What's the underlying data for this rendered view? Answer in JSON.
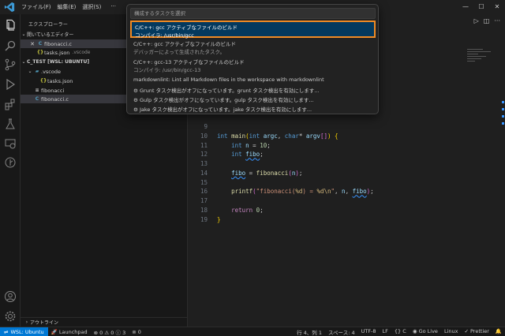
{
  "menu": {
    "file": "ファイル(F)",
    "edit": "編集(E)",
    "selection": "選択(S)",
    "more": "···"
  },
  "sidebar": {
    "title": "エクスプローラー",
    "open_editors_label": "開いているエディター",
    "open_editors": [
      {
        "name": "fibonacci.c",
        "suffix": "",
        "icon": "C"
      },
      {
        "name": "tasks.json",
        "suffix": ".vscode",
        "icon": "{}"
      }
    ],
    "workspace_label": "C_TEST [WSL: UBUNTU]",
    "tree": [
      {
        "name": ".vscode",
        "kind": "folder"
      },
      {
        "name": "tasks.json",
        "kind": "json"
      },
      {
        "name": "fibonacci",
        "kind": "file"
      },
      {
        "name": "fibonacci.c",
        "kind": "c"
      }
    ],
    "outline_label": "アウトライン"
  },
  "quickpick": {
    "placeholder": "構成するタスクを選択",
    "items": [
      {
        "l1": "C/C++: gcc アクティブなファイルのビルド",
        "l2": "コンパイラ: /usr/bin/gcc"
      },
      {
        "l1": "C/C++: gcc アクティブなファイルのビルド",
        "l2": "デバッガーによって生成されたタスク。"
      },
      {
        "l1": "C/C++: gcc-13 アクティブなファイルのビルド",
        "l2": "コンパイラ: /usr/bin/gcc-13"
      },
      {
        "l1": "markdownlint: Lint all Markdown files in the workspace with markdownlint",
        "l2": ""
      },
      {
        "l1": "Grunt タスク検出がオフになっています。grunt タスク検出を有効にします...",
        "l2": ""
      },
      {
        "l1": "Gulp タスク検出がオフになっています。gulp タスク検出を有効にします...",
        "l2": ""
      },
      {
        "l1": "Jake タスク検出がオフになっています。jake タスク検出を有効にします...",
        "l2": ""
      }
    ]
  },
  "code": {
    "line_numbers": [
      "9",
      "10",
      "11",
      "12",
      "13",
      "14",
      "15",
      "16",
      "17",
      "18",
      "19"
    ]
  },
  "status": {
    "remote": "WSL: Ubuntu",
    "launchpad": "Launchpad",
    "errors": "0",
    "warnings": "0",
    "info": "3",
    "ports": "0",
    "position": "行 4、列 1",
    "spaces": "スペース: 4",
    "encoding": "UTF-8",
    "eol": "LF",
    "lang": "C",
    "golive": "Go Live",
    "platform": "Linux",
    "prettier": "Prettier"
  },
  "colors": {
    "accent": "#0078d4",
    "focus_border": "#f08a24",
    "selection": "#04395e"
  }
}
